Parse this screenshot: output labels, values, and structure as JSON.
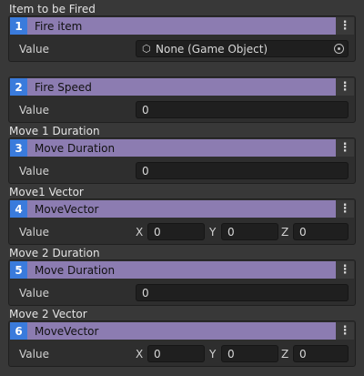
{
  "sections": [
    {
      "title": "Item to be Fired",
      "number": "1",
      "header": "Fire item",
      "value_label": "Value",
      "object_value": "None (Game Object)"
    },
    {
      "title": "",
      "number": "2",
      "header": "Fire Speed",
      "value_label": "Value",
      "value": "0"
    },
    {
      "title": "Move 1 Duration",
      "number": "3",
      "header": "Move Duration",
      "value_label": "Value",
      "value": "0"
    },
    {
      "title": "Move1 Vector",
      "number": "4",
      "header": "MoveVector",
      "value_label": "Value",
      "x_label": "X",
      "x": "0",
      "y_label": "Y",
      "y": "0",
      "z_label": "Z",
      "z": "0"
    },
    {
      "title": "Move 2 Duration",
      "number": "5",
      "header": "Move Duration",
      "value_label": "Value",
      "value": "0"
    },
    {
      "title": "Move 2 Vector",
      "number": "6",
      "header": "MoveVector",
      "value_label": "Value",
      "x_label": "X",
      "x": "0",
      "y_label": "Y",
      "y": "0",
      "z_label": "Z",
      "z": "0"
    }
  ],
  "icons": {
    "menu": "kebab-menu-icon",
    "object": "game-object-icon",
    "picker": "object-picker-icon"
  },
  "colors": {
    "index_badge": "#3a7bdc",
    "header_bar": "#8c7cb1",
    "background": "#383838"
  }
}
